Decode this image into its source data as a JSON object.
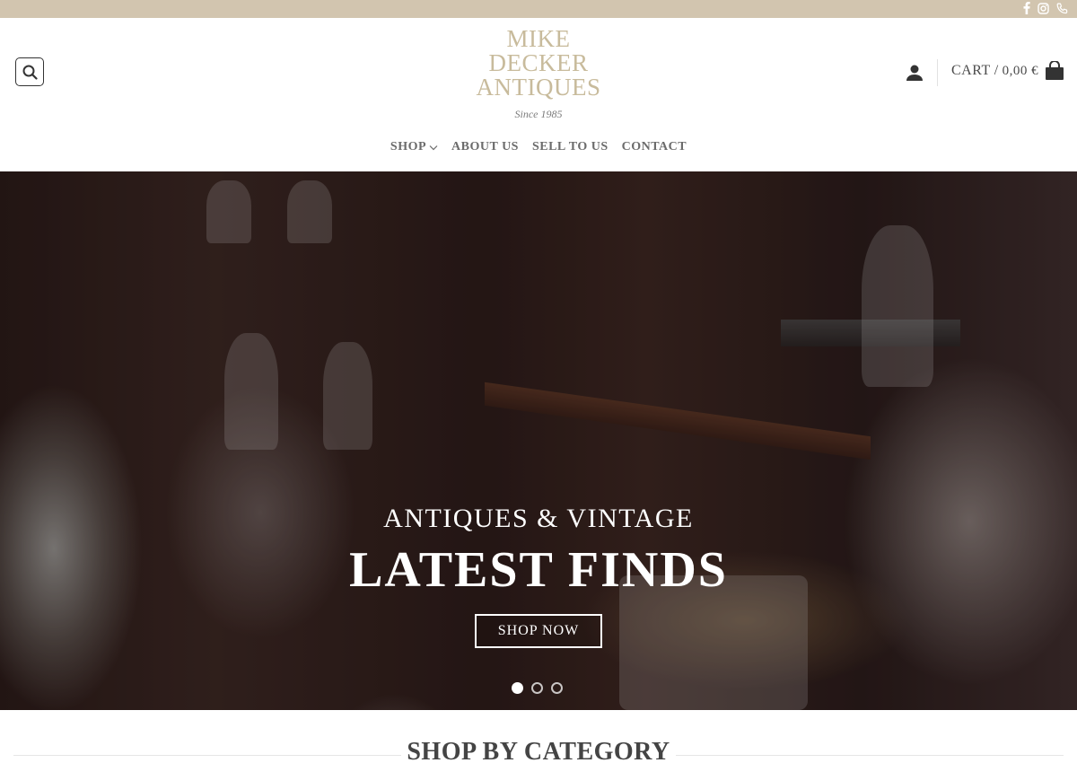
{
  "topbar": {
    "social_icons": [
      "facebook-icon",
      "instagram-icon",
      "phone-icon"
    ],
    "background": "#d2c5af"
  },
  "header": {
    "logo": {
      "line1": "MIKE",
      "line2": "DECKER",
      "line3": "ANTIQUES",
      "since": "Since 1985",
      "color": "#c8bb9c"
    },
    "search_icon": "search-icon",
    "account_icon": "user-icon",
    "cart": {
      "label": "CART",
      "separator": "/",
      "amount": "0,00 €",
      "icon": "shopping-bag-icon"
    }
  },
  "nav": {
    "items": [
      {
        "label": "SHOP",
        "has_dropdown": true
      },
      {
        "label": "ABOUT US"
      },
      {
        "label": "SELL TO US"
      },
      {
        "label": "CONTACT"
      }
    ]
  },
  "hero": {
    "subtitle": "ANTIQUES & VINTAGE",
    "title": "LATEST FINDS",
    "button_label": "SHOP NOW",
    "slides_total": 3,
    "active_slide": 1
  },
  "sections": {
    "category_title": "SHOP BY CATEGORY"
  }
}
